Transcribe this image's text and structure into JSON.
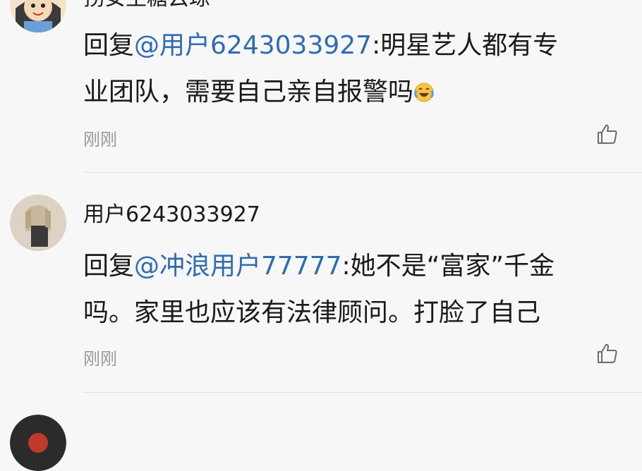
{
  "comments": [
    {
      "username": "拐安生糖云琼",
      "reply_prefix": "回复",
      "mention": "@用户6243033927",
      "body_line1": ":明星艺人都有专",
      "body_line2": "业团队，需要自己亲自报警吗",
      "emoji": "crying-laughing-emoji",
      "time": "刚刚",
      "like_icon": "thumbs-up-icon"
    },
    {
      "username": "用户6243033927",
      "reply_prefix": "回复",
      "mention": "@冲浪用户77777",
      "body_line1": ":她不是“富家”千金",
      "body_line2": "吗。家里也应该有法律顾问。打脸了自己",
      "time": "刚刚",
      "like_icon": "thumbs-up-icon"
    }
  ],
  "colors": {
    "mention": "#2f6bb5",
    "background": "#f7f7f8",
    "time": "#9a9a9a"
  }
}
